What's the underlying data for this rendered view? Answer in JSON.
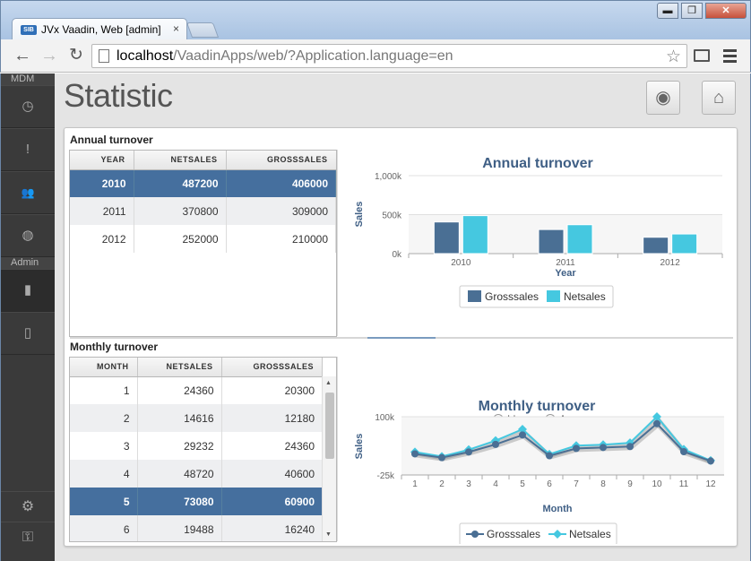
{
  "browser": {
    "tab_title": "JVx Vaadin, Web [admin]",
    "tab_close": "×",
    "favicon_text": "SIB",
    "url_host": "localhost",
    "url_path": "/VaadinApps/web/?Application.language=en",
    "win_min": "▬",
    "win_max": "❐",
    "win_close": "✕"
  },
  "sidebar": {
    "section_mdm": "MDM",
    "section_admin": "Admin",
    "items": [
      {
        "name": "clock-icon",
        "glyph": "◷"
      },
      {
        "name": "alert-icon",
        "glyph": "!"
      },
      {
        "name": "users-icon",
        "glyph": "👥"
      },
      {
        "name": "globe-icon",
        "glyph": "◍"
      },
      {
        "name": "bar-chart-icon",
        "glyph": "▮"
      },
      {
        "name": "building-chart-icon",
        "glyph": "▯"
      }
    ],
    "settings_glyph": "⚙",
    "key_glyph": "⚿"
  },
  "page": {
    "title": "Statistic"
  },
  "annual": {
    "caption": "Annual turnover",
    "columns": [
      "YEAR",
      "NETSALES",
      "GROSSSALES"
    ],
    "rows": [
      [
        "2010",
        "487200",
        "406000"
      ],
      [
        "2011",
        "370800",
        "309000"
      ],
      [
        "2012",
        "252000",
        "210000"
      ]
    ],
    "selected_row": 0
  },
  "monthly": {
    "caption": "Monthly turnover",
    "columns": [
      "MONTH",
      "NETSALES",
      "GROSSSALES"
    ],
    "rows": [
      [
        "1",
        "24360",
        "20300"
      ],
      [
        "2",
        "14616",
        "12180"
      ],
      [
        "3",
        "29232",
        "24360"
      ],
      [
        "4",
        "48720",
        "40600"
      ],
      [
        "5",
        "73080",
        "60900"
      ],
      [
        "6",
        "19488",
        "16240"
      ]
    ],
    "selected_row": 4,
    "mode_options": [
      "Lines",
      "Areas"
    ],
    "mode_selected": "Lines"
  },
  "colors": {
    "gross": "#4a6f94",
    "net": "#45c8e0",
    "selection": "#456f9e"
  },
  "chart_data": [
    {
      "type": "bar",
      "title": "Annual turnover",
      "xlabel": "Year",
      "ylabel": "Sales",
      "categories": [
        "2010",
        "2011",
        "2012"
      ],
      "yticks": [
        "0k",
        "500k",
        "1,000k"
      ],
      "ylim": [
        0,
        1000000
      ],
      "series": [
        {
          "name": "Grosssales",
          "values": [
            406000,
            309000,
            210000
          ]
        },
        {
          "name": "Netsales",
          "values": [
            487200,
            370800,
            252000
          ]
        }
      ],
      "legend": "bottom-center"
    },
    {
      "type": "line",
      "title": "Monthly turnover",
      "xlabel": "Month",
      "ylabel": "Sales",
      "categories": [
        "1",
        "2",
        "3",
        "4",
        "5",
        "6",
        "7",
        "8",
        "9",
        "10",
        "11",
        "12"
      ],
      "yticks": [
        "-25k",
        "100k"
      ],
      "ylim": [
        -25000,
        100000
      ],
      "series": [
        {
          "name": "Grosssales",
          "values": [
            20300,
            12180,
            24360,
            40600,
            60900,
            16240,
            32000,
            34000,
            36000,
            85000,
            25000,
            5000
          ]
        },
        {
          "name": "Netsales",
          "values": [
            24360,
            14616,
            29232,
            48720,
            73080,
            19488,
            38000,
            40000,
            44000,
            100000,
            30000,
            6000
          ]
        }
      ],
      "legend": "bottom-center"
    }
  ]
}
